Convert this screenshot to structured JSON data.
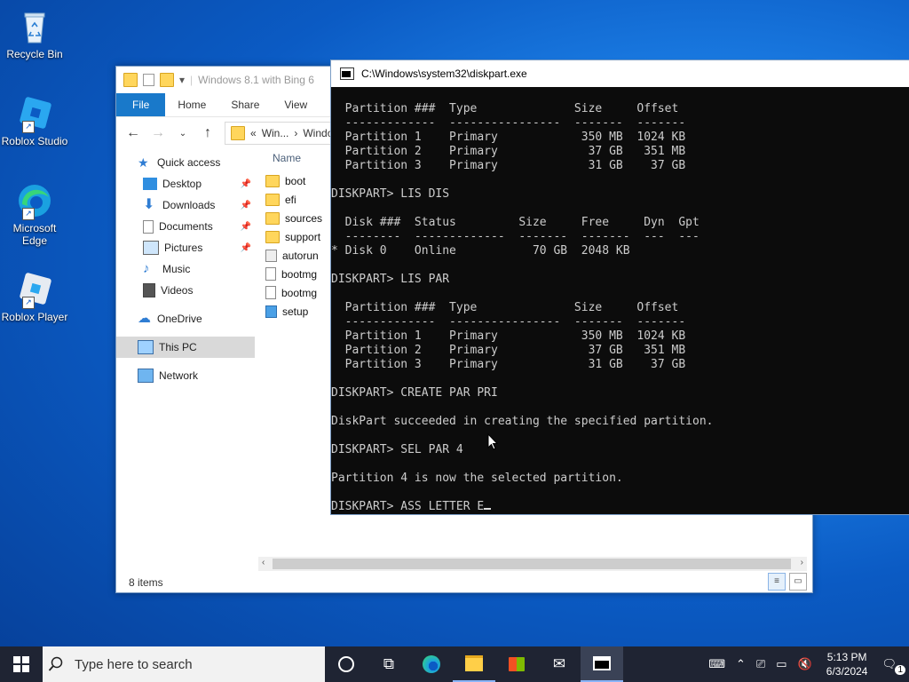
{
  "desktop": {
    "icons": [
      {
        "label": "Recycle Bin"
      },
      {
        "label": "Roblox Studio"
      },
      {
        "label": "Microsoft Edge"
      },
      {
        "label": "Roblox Player"
      }
    ]
  },
  "explorer": {
    "title": "Windows 8.1 with Bing 6",
    "ribbon_tabs": [
      "File",
      "Home",
      "Share",
      "View"
    ],
    "address": {
      "prefix": "«",
      "crumbs": [
        "Win...",
        "Window"
      ]
    },
    "nav": [
      {
        "label": "Quick access"
      },
      {
        "label": "Desktop"
      },
      {
        "label": "Downloads"
      },
      {
        "label": "Documents"
      },
      {
        "label": "Pictures"
      },
      {
        "label": "Music"
      },
      {
        "label": "Videos"
      },
      {
        "label": "OneDrive"
      },
      {
        "label": "This PC"
      },
      {
        "label": "Network"
      }
    ],
    "column_header": "Name",
    "files": [
      "boot",
      "efi",
      "sources",
      "support",
      "autorun",
      "bootmg",
      "bootmg",
      "setup"
    ],
    "status": "8 items"
  },
  "console": {
    "title": "C:\\Windows\\system32\\diskpart.exe",
    "lines": [
      "  Partition ###  Type              Size     Offset",
      "  -------------  ----------------  -------  -------",
      "  Partition 1    Primary            350 MB  1024 KB",
      "  Partition 2    Primary             37 GB   351 MB",
      "  Partition 3    Primary             31 GB    37 GB",
      "",
      "DISKPART> LIS DIS",
      "",
      "  Disk ###  Status         Size     Free     Dyn  Gpt",
      "  --------  -------------  -------  -------  ---  ---",
      "* Disk 0    Online           70 GB  2048 KB",
      "",
      "DISKPART> LIS PAR",
      "",
      "  Partition ###  Type              Size     Offset",
      "  -------------  ----------------  -------  -------",
      "  Partition 1    Primary            350 MB  1024 KB",
      "  Partition 2    Primary             37 GB   351 MB",
      "  Partition 3    Primary             31 GB    37 GB",
      "",
      "DISKPART> CREATE PAR PRI",
      "",
      "DiskPart succeeded in creating the specified partition.",
      "",
      "DISKPART> SEL PAR 4",
      "",
      "Partition 4 is now the selected partition.",
      "",
      "DISKPART> ASS LETTER E"
    ]
  },
  "taskbar": {
    "search_placeholder": "Type here to search",
    "time": "5:13 PM",
    "date": "6/3/2024",
    "notification_count": "1"
  },
  "colors": {
    "accent": "#1979ca",
    "console_bg": "#0c0c0c",
    "taskbar_bg": "#1f2433"
  }
}
